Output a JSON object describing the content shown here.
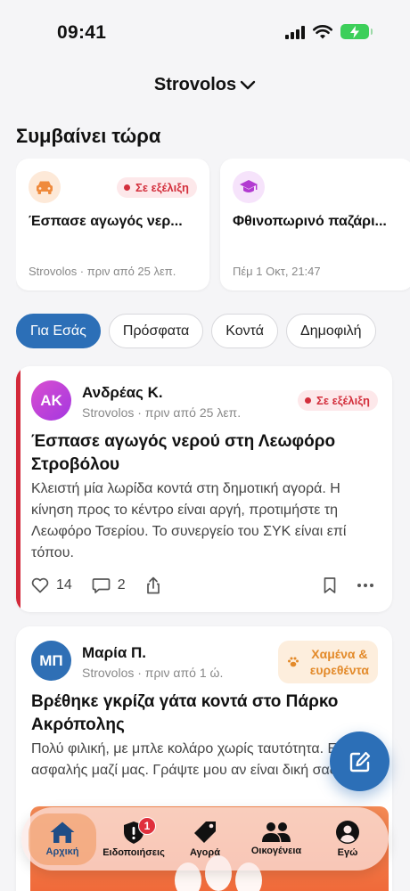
{
  "status_bar": {
    "time": "09:41"
  },
  "location": {
    "name": "Strovolos"
  },
  "happening_now": {
    "title": "Συμβαίνει τώρα",
    "cards": [
      {
        "icon": "car-icon",
        "title": "Έσπασε αγωγός νερ...",
        "badge": "Σε εξέλιξη",
        "meta": "Strovolos · πριν από 25 λεπ.",
        "icon_bg": "#fde9d8",
        "icon_color": "#ef8a3c"
      },
      {
        "icon": "graduation-cap-icon",
        "title": "Φθινοπωρινό παζάρι...",
        "badge": "",
        "meta": "Πέμ 1 Οκτ, 21:47",
        "icon_bg": "#f6e3fb",
        "icon_color": "#b23ad1"
      }
    ]
  },
  "filters": {
    "chips": [
      "Για Εσάς",
      "Πρόσφατα",
      "Κοντά",
      "Δημοφιλή"
    ],
    "active_index": 0
  },
  "posts": [
    {
      "initials": "ΑΚ",
      "author": "Ανδρέας Κ.",
      "meta": "Strovolos · πριν από 25 λεπ.",
      "badge": "Σε εξέλιξη",
      "title": "Έσπασε αγωγός νερού στη Λεωφόρο Στροβόλου",
      "body": "Κλειστή μία λωρίδα κοντά στη δημοτική αγορά. Η κίνηση προς το κέντρο είναι αργή, προτιμήστε τη Λεωφόρο Τσερίου. Το συνεργείο του ΣΥΚ είναι επί τόπου.",
      "likes": "14",
      "comments": "2"
    },
    {
      "initials": "ΜΠ",
      "author": "Μαρία Π.",
      "meta": "Strovolos · πριν από 1 ώ.",
      "badge_line1": "Χαμένα &",
      "badge_line2": "ευρεθέντα",
      "title": "Βρέθηκε γκρίζα γάτα κοντά στο Πάρκο Ακρόπολης",
      "body": "Πολύ φιλική, με μπλε κολάρο χωρίς ταυτότητα. Είναι ασφαλής μαζί μας. Γράψτε μου αν είναι δική σας!"
    }
  ],
  "tabbar": {
    "tabs": [
      {
        "label": "Αρχική",
        "icon": "home-icon"
      },
      {
        "label": "Ειδοποιήσεις",
        "icon": "alert-shield-icon",
        "badge": "1"
      },
      {
        "label": "Αγορά",
        "icon": "tag-icon"
      },
      {
        "label": "Οικογένεια",
        "icon": "people-icon"
      },
      {
        "label": "Εγώ",
        "icon": "profile-icon"
      }
    ],
    "active_index": 0
  },
  "colors": {
    "accent": "#2c6fb7",
    "live_badge": "#d32f3c",
    "lost_found_badge": "#e38a2a",
    "avatar_ak": "#c43fd8",
    "avatar_mp": "#2f6fb5"
  }
}
